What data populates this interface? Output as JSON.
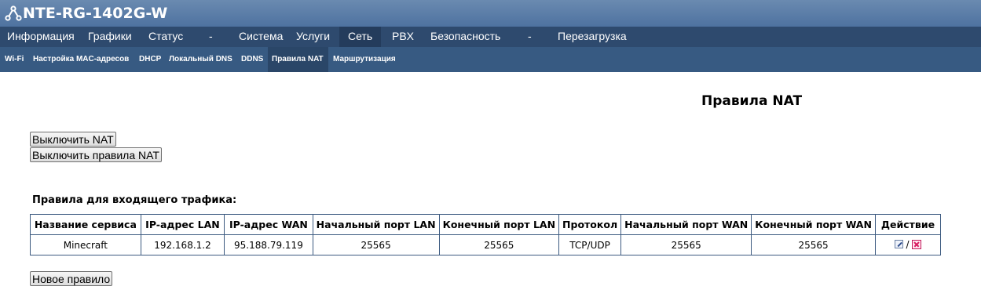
{
  "header": {
    "device_name": "NTE-RG-1402G-W",
    "logo_icon": "router-logo-icon"
  },
  "main_nav": {
    "items": [
      {
        "label": "Информация"
      },
      {
        "label": "Графики"
      },
      {
        "label": "Статус"
      },
      {
        "label": "-"
      },
      {
        "label": "Система"
      },
      {
        "label": "Услуги"
      },
      {
        "label": "Сеть",
        "active": true
      },
      {
        "label": "PBX"
      },
      {
        "label": "Безопасность"
      },
      {
        "label": "-"
      },
      {
        "label": "Перезагрузка"
      }
    ]
  },
  "sub_nav": {
    "items": [
      {
        "label": "Wi-Fi"
      },
      {
        "label": "Настройка MAC-адресов"
      },
      {
        "label": "DHCP"
      },
      {
        "label": "Локальный DNS"
      },
      {
        "label": "DDNS"
      },
      {
        "label": "Правила NAT",
        "active": true
      },
      {
        "label": "Маршрутизация"
      }
    ]
  },
  "page": {
    "title": "Правила NAT",
    "disable_nat_label": "Выключить NAT",
    "disable_rules_label": "Выключить правила NAT",
    "section_label": "Правила для входящего трафика:",
    "new_rule_label": "Новое правило"
  },
  "table": {
    "headers": [
      "Название сервиса",
      "IP-адрес LAN",
      "IP-адрес WAN",
      "Начальный порт LAN",
      "Конечный порт LAN",
      "Протокол",
      "Начальный порт WAN",
      "Конечный порт WAN",
      "Действие"
    ],
    "rows": [
      {
        "cells": [
          "Minecraft",
          "192.168.1.2",
          "95.188.79.119",
          "25565",
          "25565",
          "TCP/UDP",
          "25565",
          "25565"
        ],
        "action_separator": "/",
        "actions": {
          "edit_icon": "edit-icon",
          "delete_icon": "delete-icon"
        }
      }
    ]
  },
  "colors": {
    "header_bg": "#5577a2",
    "main_nav_bg": "#2e4a6e",
    "sub_nav_bg": "#375a82",
    "table_border": "#3c5a80",
    "delete_accent": "#d81b60"
  }
}
